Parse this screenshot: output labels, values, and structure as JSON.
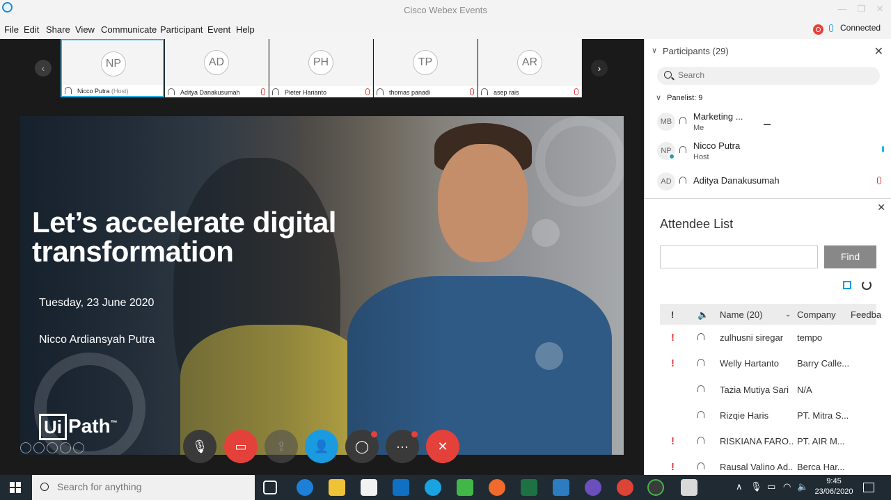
{
  "window": {
    "title": "Cisco Webex Events"
  },
  "menu": [
    "File",
    "Edit",
    "Share",
    "View",
    "Communicate",
    "Participant",
    "Event",
    "Help"
  ],
  "status": {
    "connection": "Connected"
  },
  "thumbnails": [
    {
      "initials": "NP",
      "name": "Nicco Putra",
      "role": "(Host)"
    },
    {
      "initials": "AD",
      "name": "Aditya Danakusumah",
      "role": ""
    },
    {
      "initials": "PH",
      "name": "Pieter Harianto",
      "role": ""
    },
    {
      "initials": "TP",
      "name": "thomas panadi",
      "role": ""
    },
    {
      "initials": "AR",
      "name": "asep rais",
      "role": ""
    }
  ],
  "slide": {
    "title": "Let’s accelerate digital transformation",
    "date": "Tuesday, 23 June 2020",
    "presenter": "Nicco Ardiansyah Putra",
    "logo_box": "Ui",
    "logo_rest": "Path",
    "logo_tm": "™"
  },
  "participants": {
    "title": "Participants (29)",
    "search_placeholder": "Search",
    "panelist_header": "Panelist: 9",
    "panelists": [
      {
        "initials": "MB",
        "name": "Marketing ...",
        "sub": "Me"
      },
      {
        "initials": "NP",
        "name": "Nicco Putra",
        "sub": "Host"
      },
      {
        "initials": "AD",
        "name": "Aditya Danakusumah",
        "sub": ""
      }
    ]
  },
  "attendee_list": {
    "title": "Attendee List",
    "find_label": "Find",
    "columns": {
      "flag": "!",
      "name": "Name (20)",
      "company": "Company",
      "feedback": "Feedba"
    },
    "rows": [
      {
        "flag": "!",
        "name": "zulhusni siregar",
        "company": "tempo"
      },
      {
        "flag": "!",
        "name": "Welly Hartanto",
        "company": "Barry Calle..."
      },
      {
        "flag": "",
        "name": "Tazia Mutiya Sari",
        "company": "N/A"
      },
      {
        "flag": "",
        "name": "Rizqie Haris",
        "company": "PT. Mitra S..."
      },
      {
        "flag": "!",
        "name": "RISKIANA FARO...",
        "company": "PT. AIR M..."
      },
      {
        "flag": "!",
        "name": "Rausal Valino Ad...",
        "company": "Berca Har..."
      }
    ]
  },
  "taskbar": {
    "search_placeholder": "Search for anything",
    "time": "9:45",
    "date": "23/06/2020"
  },
  "colors": {
    "accent_blue": "#1a9be0",
    "danger_red": "#e5413b",
    "thumb_active_border": "#27b3e6"
  }
}
